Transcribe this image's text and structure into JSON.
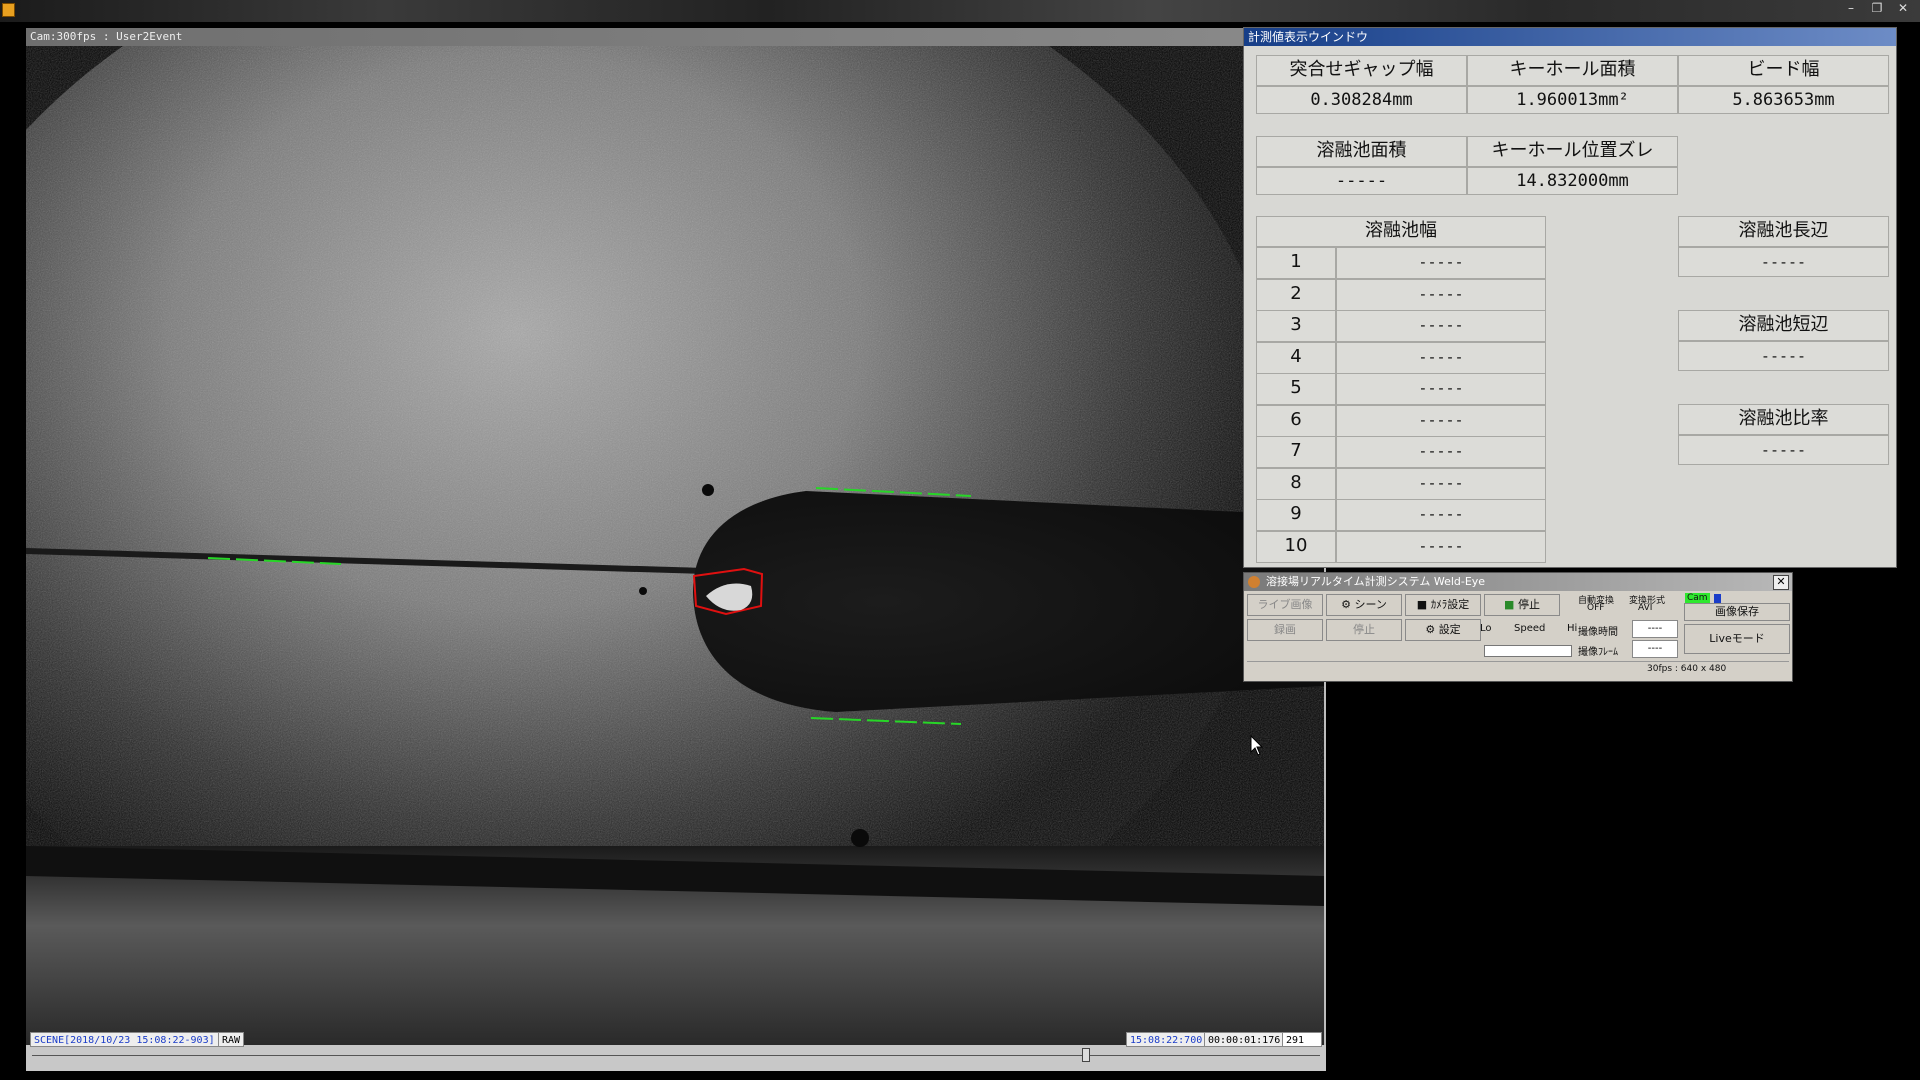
{
  "window_controls": {
    "minimize": "–",
    "maximize": "❐",
    "close": "✕"
  },
  "camera_window": {
    "title": "Cam:300fps : User2Event",
    "scene_label": "SCENE[2018/10/23 15:08:22-903]",
    "mode_label": "RAW",
    "time_current": "15:08:22:700",
    "time_elapsed": "00:00:01:176",
    "frame_number": "291",
    "timeline_position": 0.82
  },
  "measurement_window": {
    "title": "計測値表示ウインドウ",
    "top_headers": [
      "突合せギャップ幅",
      "キーホール面積",
      "ビード幅"
    ],
    "top_values": [
      "0.308284mm",
      "1.960013mm²",
      "5.863653mm"
    ],
    "mid_headers": [
      "溶融池面積",
      "キーホール位置ズレ"
    ],
    "mid_values": [
      "-----",
      "14.832000mm"
    ],
    "width_table": {
      "header": "溶融池幅",
      "rows": [
        {
          "n": "1",
          "v": "-----"
        },
        {
          "n": "2",
          "v": "-----"
        },
        {
          "n": "3",
          "v": "-----"
        },
        {
          "n": "4",
          "v": "-----"
        },
        {
          "n": "5",
          "v": "-----"
        },
        {
          "n": "6",
          "v": "-----"
        },
        {
          "n": "7",
          "v": "-----"
        },
        {
          "n": "8",
          "v": "-----"
        },
        {
          "n": "9",
          "v": "-----"
        },
        {
          "n": "10",
          "v": "-----"
        }
      ]
    },
    "side_items": [
      {
        "label": "溶融池長辺",
        "value": "-----"
      },
      {
        "label": "溶融池短辺",
        "value": "-----"
      },
      {
        "label": "溶融池比率",
        "value": "-----"
      }
    ]
  },
  "control_window": {
    "title": "溶接場リアルタイム計測システム Weld-Eye",
    "close": "✕",
    "buttons": {
      "live_image": "ライブ画像",
      "scene": "シーン",
      "camera_settings": "ｶﾒﾗ設定",
      "stop_top": "停止",
      "record": "録画",
      "stop": "停止",
      "settings": "設定",
      "save_image": "画像保存",
      "live_mode": "Liveモード"
    },
    "auto_convert_label": "自動変換",
    "auto_convert_value": "OFF",
    "convert_format_label": "変換形式",
    "convert_format_value": "AVI",
    "cam_indicator": "Cam",
    "speed_lo": "Lo",
    "speed_label": "Speed",
    "speed_hi": "Hi",
    "capture_time_label": "撮像時間",
    "capture_time_value": "----",
    "capture_frame_label": "撮像ﾌﾚｰﾑ",
    "capture_frame_value": "----",
    "status": "30fps : 640 x 480",
    "colors": {
      "cam_indicator": "#2ee82e",
      "blue_indicator": "#1a3cc8"
    }
  }
}
